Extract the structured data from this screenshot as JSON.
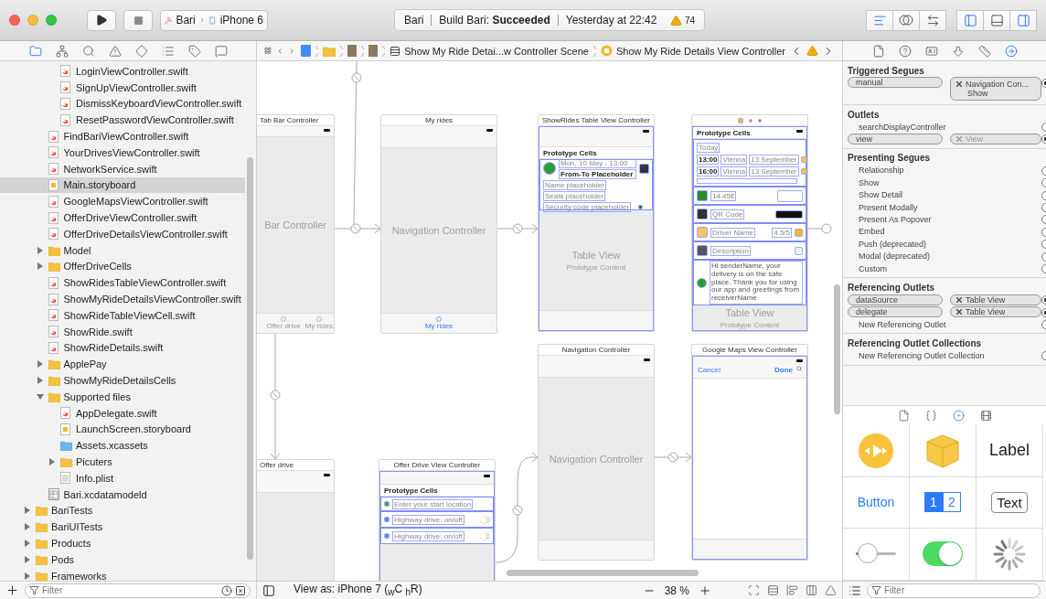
{
  "toolbar": {
    "scheme": {
      "project": "Bari",
      "device": "iPhone 6"
    },
    "activity": {
      "project": "Bari",
      "status": "Build Bari: **Succeeded**",
      "time": "Yesterday at 22:42",
      "warnings": "74"
    },
    "editor_modes": [
      {
        "kind": "standard",
        "selected": true
      },
      {
        "kind": "assistant",
        "selected": false
      },
      {
        "kind": "version",
        "selected": false
      }
    ],
    "panels": [
      {
        "kind": "navigator",
        "on": true
      },
      {
        "kind": "debug",
        "on": false
      },
      {
        "kind": "utilities",
        "on": true
      }
    ]
  },
  "navigator": {
    "tabs": [
      {
        "kind": "project",
        "selected": true
      },
      {
        "kind": "symbol",
        "selected": false
      },
      {
        "kind": "find",
        "selected": false
      },
      {
        "kind": "issue",
        "selected": false
      },
      {
        "kind": "test",
        "selected": false
      },
      {
        "kind": "debug",
        "selected": false
      },
      {
        "kind": "breakpoint",
        "selected": false
      },
      {
        "kind": "report",
        "selected": false
      }
    ],
    "tree": [
      {
        "children": [
          {
            "children": [
              {
                "label": "LoginViewController.swift",
                "kind": "swift",
                "selected": false
              },
              {
                "label": "SignUpViewController.swift",
                "kind": "swift",
                "selected": false
              },
              {
                "label": "DismissKeyboardViewController.swift",
                "kind": "swift",
                "selected": false
              },
              {
                "label": "ResetPasswordViewController.swift",
                "kind": "swift",
                "selected": false
              }
            ]
          },
          {
            "label": "FindBariViewController.swift",
            "kind": "swift",
            "selected": false
          },
          {
            "label": "YourDrivesViewController.swift",
            "kind": "swift",
            "selected": false
          },
          {
            "label": "NetworkService.swift",
            "kind": "swift",
            "selected": false
          },
          {
            "label": "Main.storyboard",
            "kind": "storyboard",
            "selected": true
          },
          {
            "label": "GoogleMapsViewController.swift",
            "kind": "swift",
            "selected": false
          },
          {
            "label": "OfferDriveViewController.swift",
            "kind": "swift",
            "selected": false
          },
          {
            "label": "OfferDriveDetailsViewController.swift",
            "kind": "swift",
            "selected": false
          },
          {
            "label": "Model",
            "kind": "folder",
            "expanded": false,
            "selected": false
          },
          {
            "label": "OfferDriveCells",
            "kind": "folder",
            "expanded": false,
            "selected": false
          },
          {
            "label": "ShowRidesTableViewController.swift",
            "kind": "swift",
            "selected": false
          },
          {
            "label": "ShowMyRideDetailsViewController.swift",
            "kind": "swift",
            "selected": false
          },
          {
            "label": "ShowRideTableViewCell.swift",
            "kind": "swift",
            "selected": false
          },
          {
            "label": "ShowRide.swift",
            "kind": "swift",
            "selected": false
          },
          {
            "label": "ShowRideDetails.swift",
            "kind": "swift",
            "selected": false
          },
          {
            "label": "ApplePay",
            "kind": "folder",
            "expanded": false,
            "selected": false
          },
          {
            "label": "ShowMyRideDetailsCells",
            "kind": "folder",
            "expanded": false,
            "selected": false
          },
          {
            "label": "Supported files",
            "kind": "folder",
            "expanded": true,
            "selected": false,
            "children": [
              {
                "label": "AppDelegate.swift",
                "kind": "swift",
                "selected": false
              },
              {
                "label": "LaunchScreen.storyboard",
                "kind": "storyboard",
                "selected": false
              },
              {
                "label": "Assets.xcassets",
                "kind": "assets",
                "selected": false
              },
              {
                "label": "Picuters",
                "kind": "folder",
                "expanded": false,
                "selected": false
              },
              {
                "label": "Info.plist",
                "kind": "plist",
                "selected": false
              }
            ]
          },
          {
            "label": "Bari.xcdatamodeld",
            "kind": "datamodel",
            "selected": false
          }
        ]
      },
      {
        "label": "BariTests",
        "kind": "folder",
        "expanded": false,
        "selected": false
      },
      {
        "label": "BariUITests",
        "kind": "folder",
        "expanded": false,
        "selected": false
      },
      {
        "label": "Products",
        "kind": "folder",
        "expanded": false,
        "selected": false
      },
      {
        "label": "Pods",
        "kind": "folder",
        "expanded": false,
        "selected": false
      },
      {
        "label": "Frameworks",
        "kind": "folder",
        "expanded": false,
        "selected": false
      }
    ],
    "filter": {
      "placeholder": "Filter"
    }
  },
  "jump_bar": {
    "path": [
      {
        "kind": "project"
      },
      {
        "kind": "folder"
      },
      {
        "kind": "file"
      },
      {
        "kind": "file"
      },
      {
        "kind": "scene",
        "label": "Show My Ride Detai...w Controller Scene"
      },
      {
        "kind": "controller",
        "label": "Show My Ride Details View Controller"
      }
    ]
  },
  "canvas": {
    "scenes": [
      {
        "kind": "tab-bar",
        "title": "Tab Bar Controller",
        "center": "Bar Controller",
        "tabs": [
          {
            "label": "Offer drive",
            "selected": false
          },
          {
            "label": "My rides",
            "selected": false
          }
        ]
      },
      {
        "kind": "navigation",
        "title": "My rides",
        "center": "Navigation Controller",
        "tabs": [
          {
            "label": "My rides",
            "selected": true
          }
        ]
      },
      {
        "kind": "table",
        "title": "ShowRides Table View Controller",
        "section": "Prototype Cells",
        "center": "Table View",
        "subtitle": "Prototype Content",
        "cells": [
          {
            "kind": "ride",
            "date": "Mon, 10 May - 13:00",
            "route": "From-To Placeholder",
            "name": "Name placeholder",
            "seats": "Seats placeholder",
            "code": "Security code placeholder"
          }
        ]
      },
      {
        "kind": "details",
        "section": "Prototype Cells",
        "center": "Table View",
        "subtitle": "Prototype Content",
        "cells": [
          {
            "kind": "trip",
            "day": "Today",
            "stops": [
              {
                "time": "13:00",
                "city": "Vienna",
                "date": "13 September"
              },
              {
                "time": "16:00",
                "city": "Vienna",
                "date": "13 September"
              }
            ]
          },
          {
            "kind": "price",
            "text": "14.45€"
          },
          {
            "kind": "qr",
            "text": "QR Code"
          },
          {
            "kind": "driver",
            "text": "Driver Name",
            "rating": "4.5/5"
          },
          {
            "kind": "description",
            "text": "Description"
          },
          {
            "kind": "message",
            "text": "Hi senderName, your delivery is on the safe place. Thank you for using our app and greetings from receiverName"
          }
        ]
      },
      {
        "kind": "navigation",
        "title": "Offer drive"
      },
      {
        "kind": "offer",
        "title": "Offer Drive View Controller",
        "section": "Prototype Cells",
        "cells": [
          {
            "kind": "location",
            "placeholder": "Enter your start location"
          },
          {
            "kind": "toggle",
            "text": "Highway drive: on/off",
            "on": false
          },
          {
            "kind": "toggle",
            "text": "Highway drive: on/off",
            "on": false
          }
        ]
      },
      {
        "kind": "navigation",
        "title": "Navigation Controller",
        "center": "Navigation Controller"
      },
      {
        "kind": "maps",
        "title": "Google Maps View Controller",
        "left": "Cancel",
        "right": "Done"
      }
    ],
    "view_as": "View as: iPhone 7 ($_{w}$C $_{h}$R)",
    "zoom": "38 %"
  },
  "inspector": {
    "tabs": [
      {
        "kind": "file",
        "selected": false
      },
      {
        "kind": "help",
        "selected": false
      },
      {
        "kind": "identity",
        "selected": false
      },
      {
        "kind": "attributes",
        "selected": false
      },
      {
        "kind": "size",
        "selected": false
      },
      {
        "kind": "connections",
        "selected": true
      }
    ],
    "sections": [
      {
        "title": "Triggered Segues",
        "rows": [
          {
            "kind": "connection",
            "label": "manual",
            "target": "Navigation Con...",
            "detail": "Show",
            "dimmed": false,
            "connected": true
          }
        ]
      },
      {
        "title": "Outlets",
        "rows": [
          {
            "kind": "outlet",
            "label": "searchDisplayController",
            "connected": false
          },
          {
            "kind": "connection",
            "label": "view",
            "target": "View",
            "dimmed": true,
            "connected": true
          }
        ]
      },
      {
        "title": "Presenting Segues",
        "rows": [
          {
            "kind": "outlet",
            "label": "Relationship",
            "connected": false
          },
          {
            "kind": "outlet",
            "label": "Show",
            "connected": false
          },
          {
            "kind": "outlet",
            "label": "Show Detail",
            "connected": false
          },
          {
            "kind": "outlet",
            "label": "Present Modally",
            "connected": false
          },
          {
            "kind": "outlet",
            "label": "Present As Popover",
            "connected": false
          },
          {
            "kind": "outlet",
            "label": "Embed",
            "connected": false
          },
          {
            "kind": "outlet",
            "label": "Push (deprecated)",
            "connected": false
          },
          {
            "kind": "outlet",
            "label": "Modal (deprecated)",
            "connected": false
          },
          {
            "kind": "outlet",
            "label": "Custom",
            "connected": false
          }
        ]
      },
      {
        "title": "Referencing Outlets",
        "rows": [
          {
            "kind": "connection",
            "label": "dataSource",
            "target": "Table View",
            "dimmed": false,
            "connected": true
          },
          {
            "kind": "connection",
            "label": "delegate",
            "target": "Table View",
            "dimmed": false,
            "connected": true
          },
          {
            "kind": "outlet",
            "label": "New Referencing Outlet",
            "connected": false
          }
        ]
      },
      {
        "title": "Referencing Outlet Collections",
        "rows": [
          {
            "kind": "outlet",
            "label": "New Referencing Outlet Collection",
            "connected": false
          }
        ]
      }
    ]
  },
  "library": {
    "tabs": [
      {
        "kind": "file",
        "selected": false
      },
      {
        "kind": "code",
        "selected": false
      },
      {
        "kind": "object",
        "selected": true
      },
      {
        "kind": "media",
        "selected": false
      }
    ],
    "items": [
      {
        "kind": "media"
      },
      {
        "kind": "object"
      },
      {
        "kind": "label",
        "text": "Label"
      },
      {
        "kind": "button",
        "text": "Button"
      },
      {
        "kind": "segmented",
        "segments": [
          {
            "label": "1",
            "selected": true
          },
          {
            "label": "2",
            "selected": false
          }
        ]
      },
      {
        "kind": "textfield",
        "text": "Text"
      },
      {
        "kind": "slider",
        "level": 0.3
      },
      {
        "kind": "switch",
        "on": true
      },
      {
        "kind": "activity"
      }
    ],
    "filter": {
      "placeholder": "Filter"
    }
  }
}
